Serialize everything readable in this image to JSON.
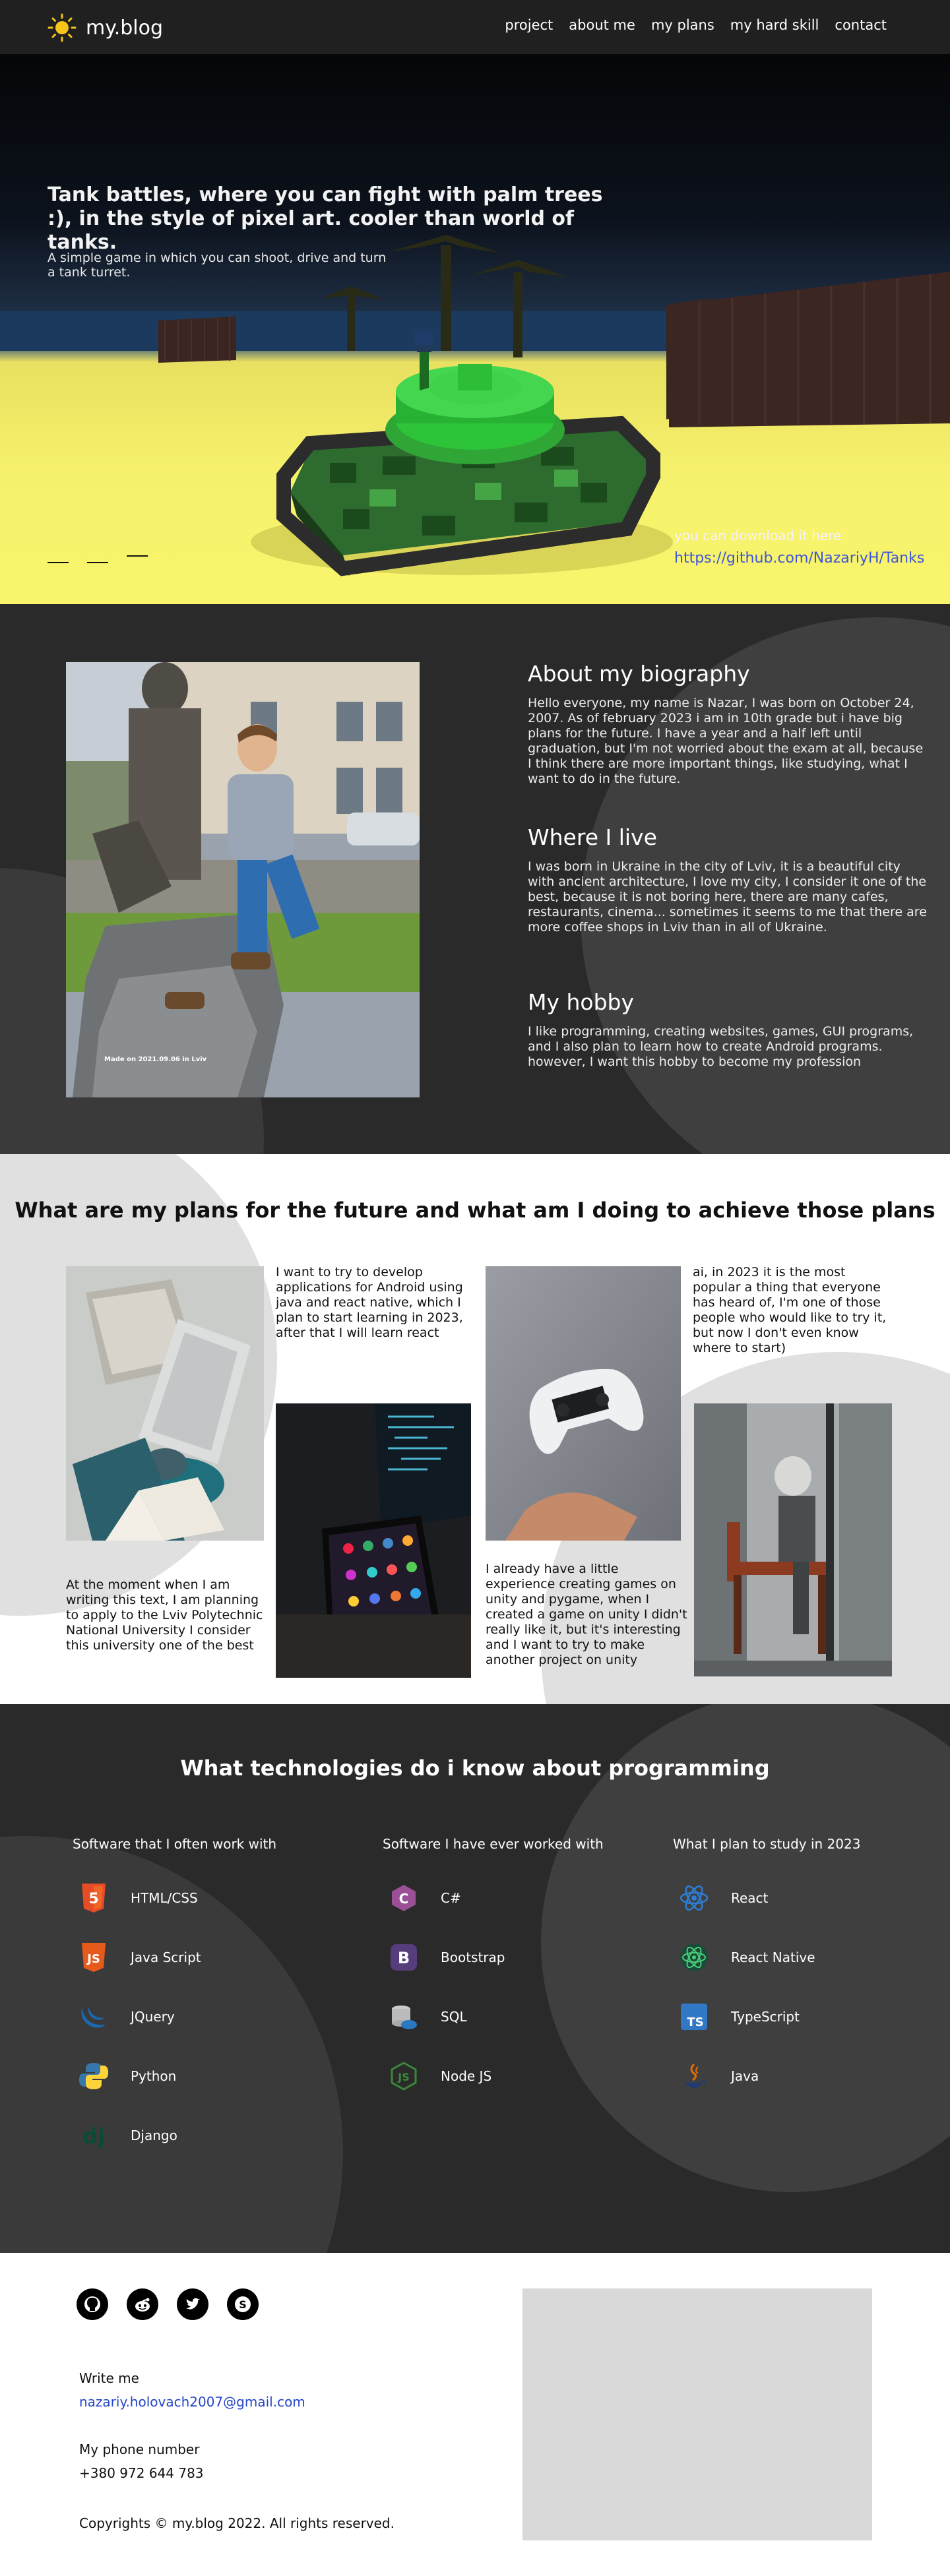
{
  "header": {
    "logo_text": "my.blog",
    "logo_icon": "sun-icon",
    "nav": [
      "project",
      "about me",
      "my plans",
      "my hard skill",
      "contact"
    ]
  },
  "hero": {
    "title": "Tank battles, where you can fight with palm trees :), in the style of pixel art. cooler than world of tanks.",
    "subtitle": "A simple game in which you can shoot, drive and turn a tank turret.",
    "download_label": "you can download it here",
    "download_link": "https://github.com/NazariyH/Tanks"
  },
  "bio": {
    "photo_caption": "Made on 2021.09.06 in Lviv",
    "blocks": [
      {
        "title": "About my biography",
        "text": "Hello everyone, my name is Nazar, I was born on October 24, 2007. As of february 2023 i am in 10th grade but i have big plans for the future. I have a year and a half left until graduation, but I'm not worried about the exam at all, because I think there are more important things, like studying, what I want to do in the future."
      },
      {
        "title": "Where I live",
        "text": "I was born in Ukraine in the city of Lviv, it is a beautiful city with ancient architecture, I love my city, I consider it one of the best, because it is not boring here, there are many cafes, restaurants, cinema... sometimes it seems to me that there are more coffee shops in Lviv than in all of Ukraine."
      },
      {
        "title": "My hobby",
        "text": "I like programming, creating websites, games, GUI programs, and I also plan to learn how to create Android programs. however, I want this hobby to become my profession"
      }
    ]
  },
  "plans": {
    "title": "What are my plans for the future and what am I doing to achieve those plans",
    "texts": [
      "I want to try to develop applications for Android using java and react native, which I plan to start learning in 2023, after that I will learn react",
      "ai, in 2023 it is the most popular a thing that everyone has heard of, I'm one of those people who would like to try it, but now I don't even know where to start)",
      "At the moment when I am writing this text, I am planning to apply to the Lviv Polytechnic National University I consider this university one of the best",
      "I already have a little experience creating games on unity and pygame, when I created a game on unity I didn't really like it, but it's interesting and I want to try to make another project on unity"
    ]
  },
  "tech": {
    "title": "What technologies do i know about programming",
    "columns": [
      {
        "heading": "Software that I often work with",
        "items": [
          {
            "label": "HTML/CSS",
            "icon": "html5-icon"
          },
          {
            "label": "Java Script",
            "icon": "javascript-icon"
          },
          {
            "label": "JQuery",
            "icon": "jquery-icon"
          },
          {
            "label": "Python",
            "icon": "python-icon"
          },
          {
            "label": "Django",
            "icon": "django-icon"
          }
        ]
      },
      {
        "heading": "Software I have ever worked with",
        "items": [
          {
            "label": "C#",
            "icon": "csharp-icon"
          },
          {
            "label": "Bootstrap",
            "icon": "bootstrap-icon"
          },
          {
            "label": "SQL",
            "icon": "sql-icon"
          },
          {
            "label": "Node JS",
            "icon": "nodejs-icon"
          }
        ]
      },
      {
        "heading": "What I plan to study in 2023",
        "items": [
          {
            "label": "React",
            "icon": "react-icon"
          },
          {
            "label": "React Native",
            "icon": "react-native-icon"
          },
          {
            "label": "TypeScript",
            "icon": "typescript-icon"
          },
          {
            "label": "Java",
            "icon": "java-icon"
          }
        ]
      }
    ]
  },
  "footer": {
    "socials": [
      "github-icon",
      "reddit-icon",
      "twitter-icon",
      "skype-icon"
    ],
    "write_me_label": "Write me",
    "email": "nazariy.holovach2007@gmail.com",
    "phone_label": "My phone number",
    "phone": "+380 972 644 783",
    "copyright": "Copyrights © my.blog 2022. All rights reserved."
  }
}
